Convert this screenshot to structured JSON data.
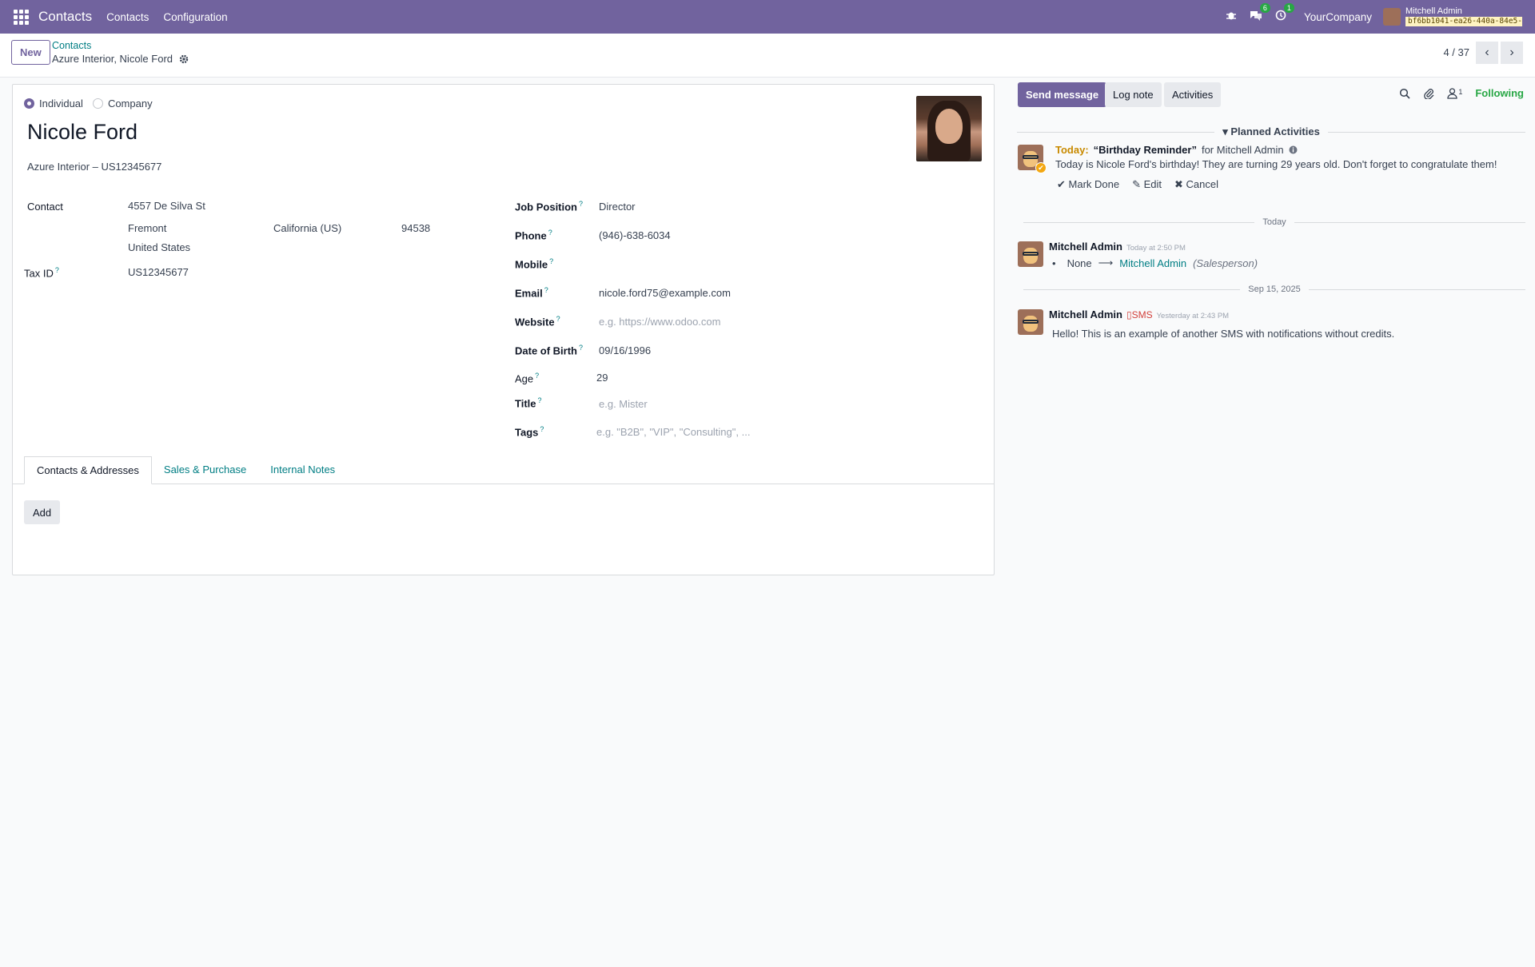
{
  "topbar": {
    "app_name": "Contacts",
    "menu": [
      "Contacts",
      "Configuration"
    ],
    "chat_badge": "6",
    "activity_badge": "1",
    "company": "YourCompany",
    "user_name": "Mitchell Admin",
    "db_tag": "bf6bb1041-ea26-440a-84e5-d..."
  },
  "control": {
    "new_label": "New",
    "breadcrumb_parent": "Contacts",
    "breadcrumb_current": "Azure Interior, Nicole Ford",
    "pager": "4 / 37"
  },
  "form": {
    "type_individual": "Individual",
    "type_company": "Company",
    "name": "Nicole Ford",
    "company_line": "Azure Interior – US12345677",
    "contact_label": "Contact",
    "street": "4557 De Silva St",
    "city": "Fremont",
    "state": "California (US)",
    "zip": "94538",
    "country": "United States",
    "taxid_label": "Tax ID",
    "taxid_value": "US12345677",
    "job_label": "Job Position",
    "job_value": "Director",
    "phone_label": "Phone",
    "phone_value": "(946)-638-6034",
    "mobile_label": "Mobile",
    "email_label": "Email",
    "email_value": "nicole.ford75@example.com",
    "website_label": "Website",
    "website_placeholder": "e.g. https://www.odoo.com",
    "dob_label": "Date of Birth",
    "dob_value": "09/16/1996",
    "age_label": "Age",
    "age_value": "29",
    "title_label": "Title",
    "title_placeholder": "e.g. Mister",
    "tags_label": "Tags",
    "tags_placeholder": "e.g. \"B2B\", \"VIP\", \"Consulting\", ...",
    "help_mark": "?"
  },
  "tabs": [
    "Contacts & Addresses",
    "Sales & Purchase",
    "Internal Notes"
  ],
  "add_label": "Add",
  "chatter": {
    "send_message": "Send message",
    "log_note": "Log note",
    "activities": "Activities",
    "followers_count": "1",
    "following": "Following",
    "planned_heading": "Planned Activities",
    "activity": {
      "when": "Today:",
      "title": "“Birthday Reminder”",
      "for": "for Mitchell Admin",
      "body": "Today is Nicole Ford's birthday! They are turning 29 years old. Don't forget to congratulate them!",
      "mark_done": "Mark Done",
      "edit": "Edit",
      "cancel": "Cancel"
    },
    "sep_today": "Today",
    "msg1": {
      "author": "Mitchell Admin",
      "time": "Today at 2:50 PM",
      "old": "None",
      "new": "Mitchell Admin",
      "field": "(Salesperson)"
    },
    "sep_date": "Sep 15, 2025",
    "msg2": {
      "author": "Mitchell Admin",
      "channel": "SMS",
      "time": "Yesterday at 2:43 PM",
      "body": "Hello! This is an example of another SMS with notifications without credits."
    }
  }
}
